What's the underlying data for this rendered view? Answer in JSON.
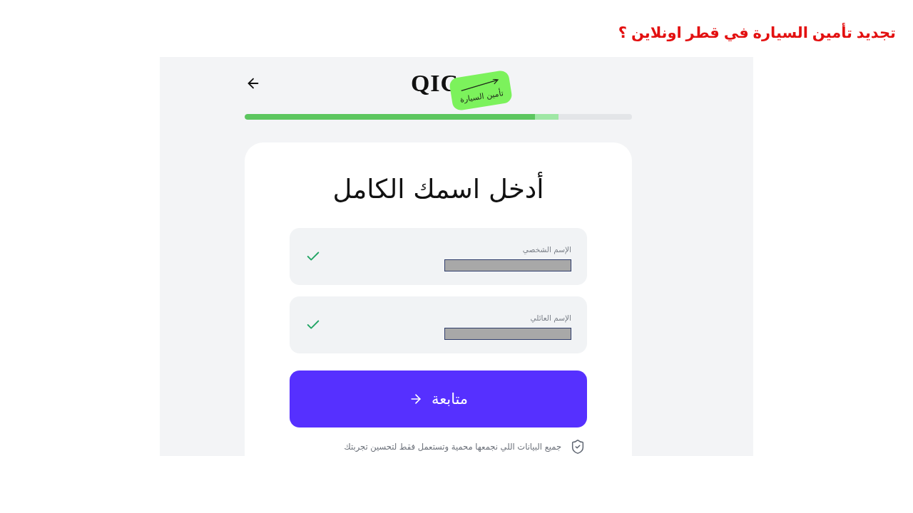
{
  "page_title": "تجديد تأمين السيارة في قطر اونلاين ؟",
  "app": {
    "logo": {
      "text": "QIC",
      "badge": "تأمين السيارة"
    },
    "progress": [
      {
        "kind": "done",
        "level": 0.75
      },
      {
        "kind": "current",
        "level": 0.81
      }
    ],
    "form": {
      "heading": "أدخل اسمك الكامل",
      "fields": [
        {
          "label": "الإسم الشخصي",
          "valid": true,
          "redacted": true
        },
        {
          "label": "الإسم العائلي",
          "valid": true,
          "redacted": true
        }
      ],
      "submit_button": "متابعة",
      "privacy_note": "جميع البيانات اللي نجمعها محمية وتستعمل فقط لتحسين تجربتك"
    }
  }
}
